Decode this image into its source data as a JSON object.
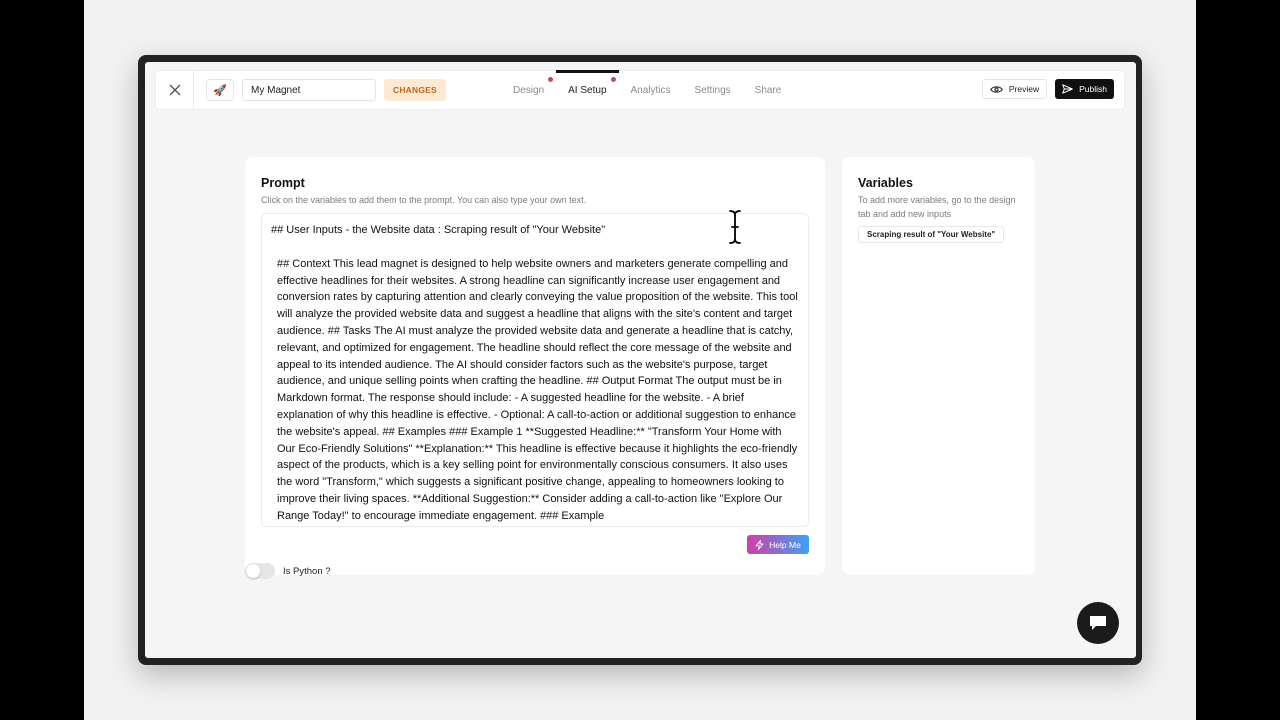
{
  "topbar": {
    "close_icon": "close-icon",
    "rocket_icon": "rocket-icon",
    "title_value": "My Magnet",
    "changes_label": "CHANGES",
    "tabs": [
      {
        "label": "Design",
        "dot": true,
        "active": false
      },
      {
        "label": "AI Setup",
        "dot": true,
        "active": true
      },
      {
        "label": "Analytics",
        "dot": false,
        "active": false
      },
      {
        "label": "Settings",
        "dot": false,
        "active": false
      },
      {
        "label": "Share",
        "dot": false,
        "active": false
      }
    ],
    "preview_label": "Preview",
    "publish_label": "Publish"
  },
  "prompt": {
    "title": "Prompt",
    "subtitle": "Click on the variables to add them to the prompt. You can also type your own text.",
    "first_line": "## User Inputs - the Website data : Scraping result of \"Your Website\"",
    "body": "## Context This lead magnet is designed to help website owners and marketers generate compelling and effective headlines for their websites. A strong headline can significantly increase user engagement and conversion rates by capturing attention and clearly conveying the value proposition of the website. This tool will analyze the provided website data and suggest a headline that aligns with the site's content and target audience. ## Tasks The AI must analyze the provided website data and generate a headline that is catchy, relevant, and optimized for engagement. The headline should reflect the core message of the website and appeal to its intended audience. The AI should consider factors such as the website's purpose, target audience, and unique selling points when crafting the headline. ## Output Format The output must be in Markdown format. The response should include: - A suggested headline for the website. - A brief explanation of why this headline is effective. - Optional: A call-to-action or additional suggestion to enhance the website's appeal. ## Examples ### Example 1 **Suggested Headline:** \"Transform Your Home with Our Eco-Friendly Solutions\" **Explanation:** This headline is effective because it highlights the eco-friendly aspect of the products, which is a key selling point for environmentally conscious consumers. It also uses the word \"Transform,\" which suggests a significant positive change, appealing to homeowners looking to improve their living spaces. **Additional Suggestion:** Consider adding a call-to-action like \"Explore Our Range Today!\" to encourage immediate engagement. ### Example",
    "help_label": "Help Me",
    "python_toggle_label": "Is Python ?",
    "python_toggle_on": false
  },
  "variables": {
    "title": "Variables",
    "subtitle": "To add more variables, go to the design tab and add new inputs",
    "chips": [
      "Scraping result of \"Your Website\""
    ]
  },
  "colors": {
    "changes_bg": "#fde9d4",
    "changes_text": "#c2661b",
    "tab_dot": "#c74b4b",
    "publish_bg": "#111111",
    "help_gradient_start": "#d43da9",
    "help_gradient_end": "#3aa3f0"
  }
}
